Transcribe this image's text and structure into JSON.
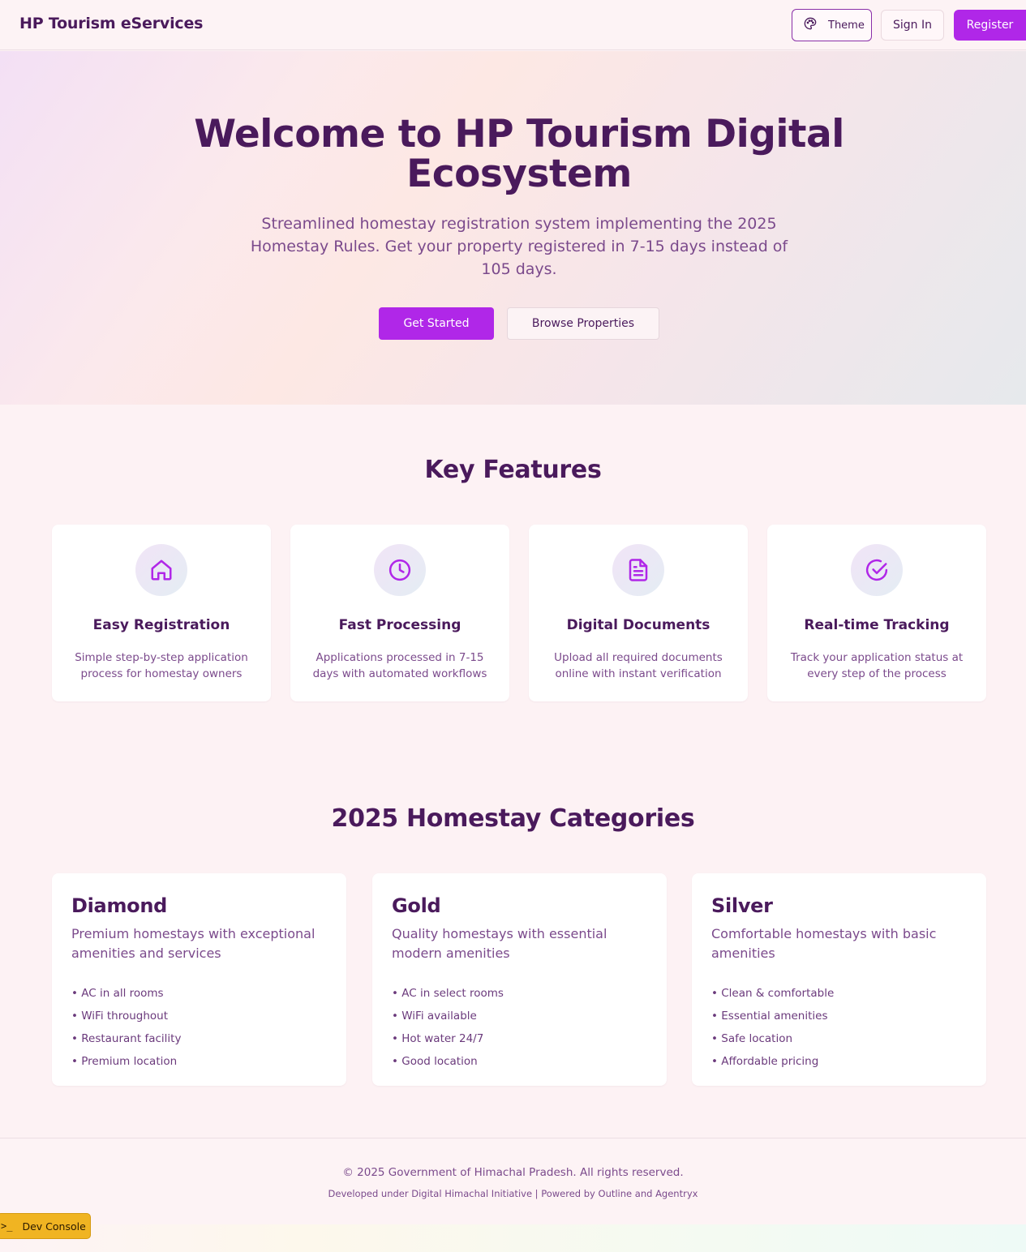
{
  "header": {
    "brand": "HP Tourism eServices",
    "theme_label": "Theme",
    "signin_label": "Sign In",
    "register_label": "Register"
  },
  "hero": {
    "title": "Welcome to HP Tourism Digital Ecosystem",
    "subtitle": "Streamlined homestay registration system implementing the 2025 Homestay Rules. Get your property registered in 7-15 days instead of 105 days.",
    "primary_cta": "Get Started",
    "secondary_cta": "Browse Properties"
  },
  "features": {
    "heading": "Key Features",
    "items": [
      {
        "icon": "home-icon",
        "title": "Easy Registration",
        "description": "Simple step-by-step application process for homestay owners"
      },
      {
        "icon": "clock-icon",
        "title": "Fast Processing",
        "description": "Applications processed in 7-15 days with automated workflows"
      },
      {
        "icon": "document-icon",
        "title": "Digital Documents",
        "description": "Upload all required documents online with instant verification"
      },
      {
        "icon": "check-circle-icon",
        "title": "Real-time Tracking",
        "description": "Track your application status at every step of the process"
      }
    ]
  },
  "categories": {
    "heading": "2025 Homestay Categories",
    "items": [
      {
        "name": "Diamond",
        "description": "Premium homestays with exceptional amenities and services",
        "features": [
          "• AC in all rooms",
          "• WiFi throughout",
          "• Restaurant facility",
          "• Premium location"
        ]
      },
      {
        "name": "Gold",
        "description": "Quality homestays with essential modern amenities",
        "features": [
          "• AC in select rooms",
          "• WiFi available",
          "• Hot water 24/7",
          "• Good location"
        ]
      },
      {
        "name": "Silver",
        "description": "Comfortable homestays with basic amenities",
        "features": [
          "• Clean & comfortable",
          "• Essential amenities",
          "• Safe location",
          "• Affordable pricing"
        ]
      }
    ]
  },
  "footer": {
    "copyright": "© 2025 Government of Himachal Pradesh. All rights reserved.",
    "credit": "Developed under Digital Himachal Initiative | Powered by Outline and Agentryx"
  },
  "dev_console": {
    "prompt": ">_",
    "label": "Dev Console"
  },
  "colors": {
    "accent": "#b027e8",
    "heading": "#4a1a5c",
    "muted_text": "#7b4a8c",
    "dev_console_bg": "#f0b422"
  }
}
